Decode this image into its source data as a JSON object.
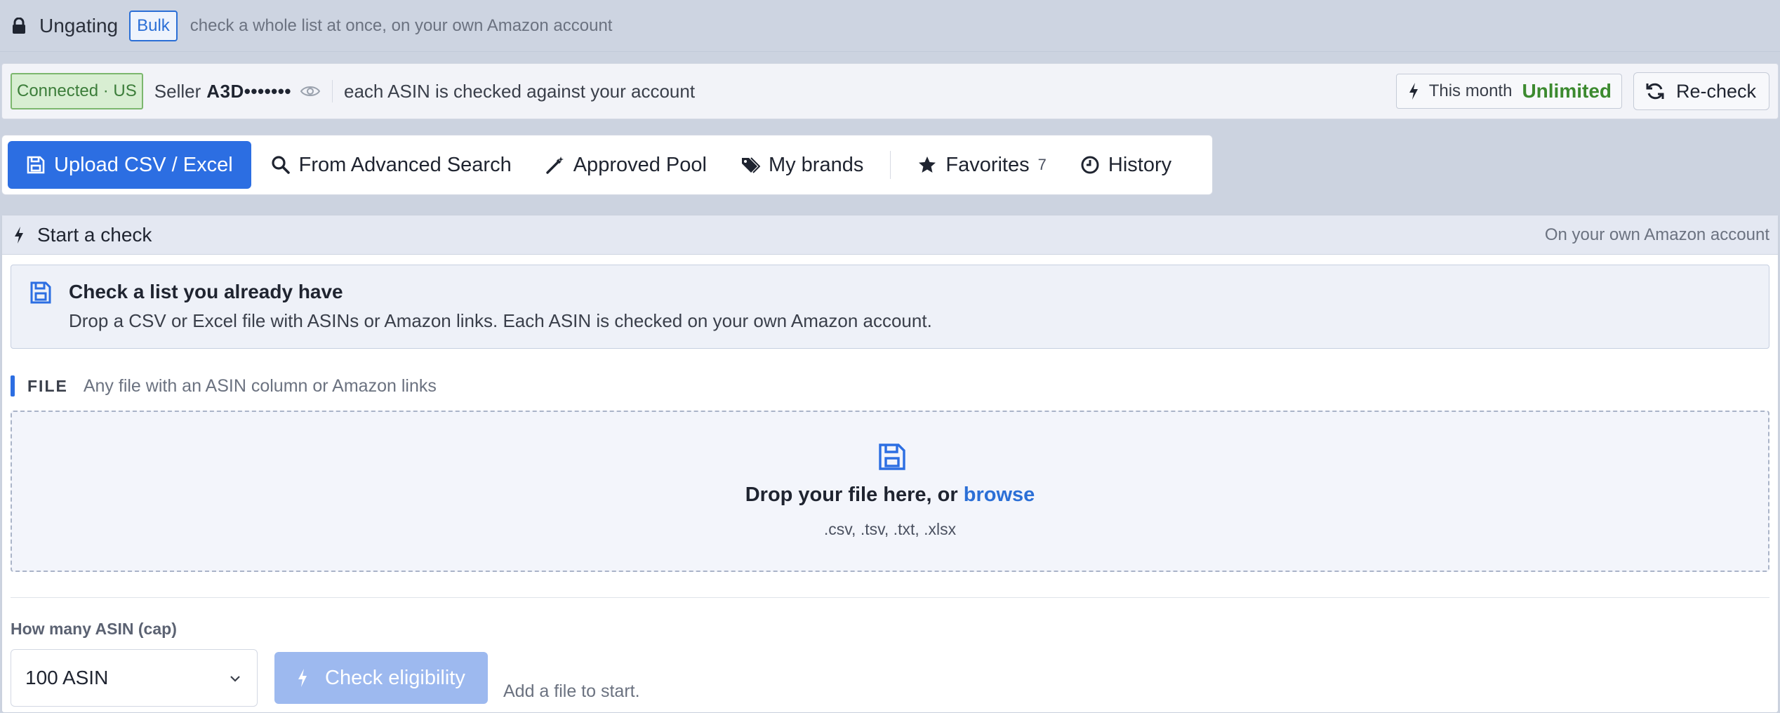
{
  "header": {
    "title": "Ungating",
    "badge": "Bulk",
    "description": "check a whole list at once, on your own Amazon account"
  },
  "status": {
    "connection": "Connected · US",
    "seller_label": "Seller",
    "seller_id": "A3D•••••••",
    "description": "each ASIN is checked against your account",
    "month_label": "This month",
    "month_value": "Unlimited",
    "recheck_label": "Re-check"
  },
  "tabs": [
    {
      "label": "Upload CSV / Excel",
      "icon": "save-icon",
      "active": true
    },
    {
      "label": "From Advanced Search",
      "icon": "search-icon"
    },
    {
      "label": "Approved Pool",
      "icon": "magic-wand-icon"
    },
    {
      "label": "My brands",
      "icon": "tags-icon"
    },
    {
      "label": "Favorites",
      "icon": "star-icon",
      "count": "7"
    },
    {
      "label": "History",
      "icon": "clock-icon"
    }
  ],
  "panel": {
    "title": "Start a check",
    "right_note": "On your own Amazon account",
    "info_title": "Check a list you already have",
    "info_desc": "Drop a CSV or Excel file with ASINs or Amazon links. Each ASIN is checked on your own Amazon account.",
    "file_label": "FILE",
    "file_hint": "Any file with an ASIN column or Amazon links",
    "drop_text": "Drop your file here, or",
    "drop_link": "browse",
    "drop_types": ".csv, .tsv, .txt, .xlsx",
    "cap_label": "How many ASIN (cap)",
    "cap_value": "100 ASIN",
    "check_button": "Check eligibility",
    "check_hint": "Add a file to start."
  },
  "colors": {
    "accent": "#2c6ee2",
    "connected_bg": "#d8eed2",
    "unlimited": "#3c8a2f",
    "disabled_button": "#9db9ef"
  }
}
